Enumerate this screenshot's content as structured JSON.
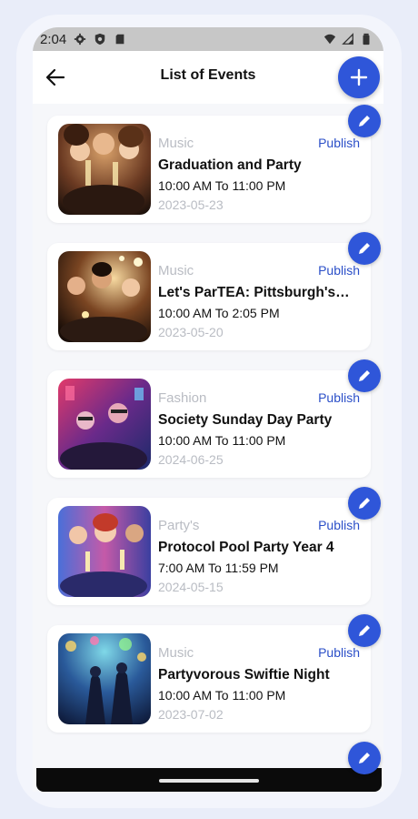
{
  "status_bar": {
    "time": "2:04",
    "icons": [
      "gear-icon",
      "shield-icon",
      "sd-card-icon",
      "wifi-icon",
      "signal-icon",
      "battery-icon"
    ]
  },
  "header": {
    "title": "List of Events",
    "back_icon": "arrow-left-icon",
    "add_icon": "plus-icon"
  },
  "colors": {
    "accent": "#2f56d9",
    "publish": "#2b4fc8",
    "muted": "#b9bcc3"
  },
  "events": [
    {
      "category": "Music",
      "status": "Publish",
      "title": "Graduation and Party",
      "time": "10:00 AM To 11:00 PM",
      "date": "2023-05-23"
    },
    {
      "category": "Music",
      "status": "Publish",
      "title": "Let's ParTEA: Pittsburgh's ...",
      "time": "10:00 AM To 2:05 PM",
      "date": "2023-05-20"
    },
    {
      "category": "Fashion",
      "status": "Publish",
      "title": "Society Sunday Day Party",
      "time": "10:00 AM To 11:00 PM",
      "date": "2024-06-25"
    },
    {
      "category": "Party's",
      "status": "Publish",
      "title": "Protocol Pool Party Year 4",
      "time": "7:00 AM To 11:59 PM",
      "date": "2024-05-15"
    },
    {
      "category": "Music",
      "status": "Publish",
      "title": "Partyvorous Swiftie Night",
      "time": "10:00 AM To 11:00 PM",
      "date": "2023-07-02"
    }
  ]
}
